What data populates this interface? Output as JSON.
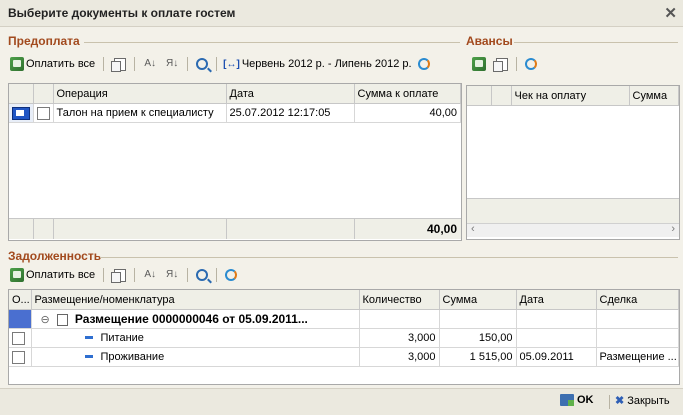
{
  "window": {
    "title": "Выберите документы к оплате гостем"
  },
  "prepay": {
    "label": "Предоплата",
    "toolbar": {
      "pay_all": "Оплатить все",
      "period": "Червень 2012 р. - Липень 2012 р."
    },
    "columns": [
      "Операция",
      "Дата",
      "Сумма к оплате"
    ],
    "rows": [
      {
        "operation": "Талон на прием к специалисту",
        "date": "25.07.2012 12:17:05",
        "amount": "40,00"
      }
    ],
    "total": "40,00"
  },
  "advances": {
    "label": "Авансы",
    "columns": [
      "Чек на оплату",
      "Сумма"
    ]
  },
  "debt": {
    "label": "Задолженность",
    "toolbar": {
      "pay_all": "Оплатить все"
    },
    "columns": [
      "О...",
      "Размещение/номенклатура",
      "Количество",
      "Сумма",
      "Дата",
      "Сделка"
    ],
    "group": {
      "title": "Размещение 0000000046 от 05.09.2011..."
    },
    "rows": [
      {
        "name": "Питание",
        "qty": "3,000",
        "sum": "150,00",
        "date": "",
        "deal": ""
      },
      {
        "name": "Проживание",
        "qty": "3,000",
        "sum": "1 515,00",
        "date": "05.09.2011",
        "deal": "Размещение ..."
      }
    ]
  },
  "footer": {
    "ok": "OK",
    "close": "Закрыть"
  }
}
